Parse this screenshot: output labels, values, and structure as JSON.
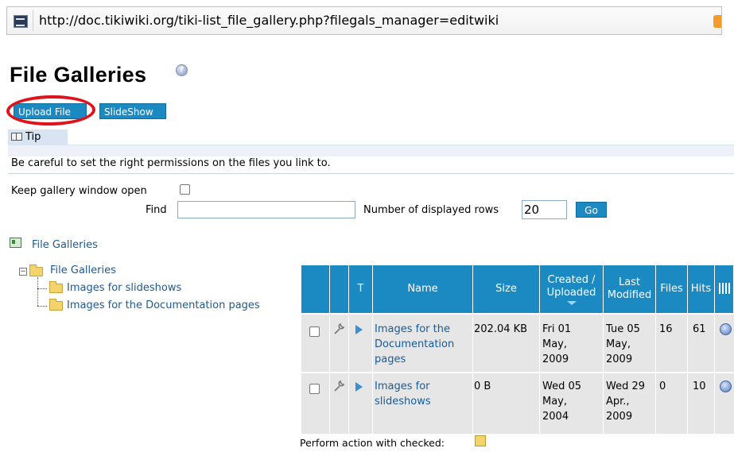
{
  "browser": {
    "url": "http://doc.tikiwiki.org/tiki-list_file_gallery.php?filegals_manager=editwiki",
    "icons": {
      "favicon": "site-favicon",
      "feed": "rss-feed-icon"
    }
  },
  "page": {
    "title": "File Galleries",
    "help_icon": "help-icon"
  },
  "actions": {
    "upload_label": "Upload File",
    "slideshow_label": "SlideShow"
  },
  "annotation": {
    "highlight_color": "#e0121b"
  },
  "tip": {
    "tab_label": "Tip",
    "text": "Be careful to set the right permissions on the files you link to."
  },
  "form": {
    "keep_open_label": "Keep gallery window open",
    "find_label": "Find",
    "find_value": "",
    "rows_label": "Number of displayed rows",
    "rows_value": "20",
    "go_label": "Go"
  },
  "nav": {
    "galleries_link": "File Galleries"
  },
  "tree": {
    "root": "File Galleries",
    "children": [
      "Images for slideshows",
      "Images for the Documentation pages"
    ]
  },
  "table": {
    "headers": {
      "type": "T",
      "name": "Name",
      "size": "Size",
      "created_line1": "Created /",
      "created_line2": "Uploaded",
      "modified_line1": "Last",
      "modified_line2": "Modified",
      "files": "Files",
      "hits": "Hits"
    },
    "rows": [
      {
        "name_lines": [
          "Images for the",
          "Documentation",
          "pages"
        ],
        "size": "202.04 KB",
        "created_lines": [
          "Fri 01",
          "May,",
          "2009"
        ],
        "modified_lines": [
          "Tue 05",
          "May,",
          "2009"
        ],
        "files": "16",
        "hits": "61"
      },
      {
        "name_lines": [
          "Images for",
          "slideshows"
        ],
        "size": "0 B",
        "created_lines": [
          "Wed 05",
          "May,",
          "2004"
        ],
        "modified_lines": [
          "Wed 29",
          "Apr.,",
          "2009"
        ],
        "files": "0",
        "hits": "10"
      }
    ],
    "footer": "Perform action with checked:"
  },
  "colors": {
    "accent": "#1b8ac3",
    "link": "#1a5a96",
    "row_bg": "#e6e6e6"
  }
}
